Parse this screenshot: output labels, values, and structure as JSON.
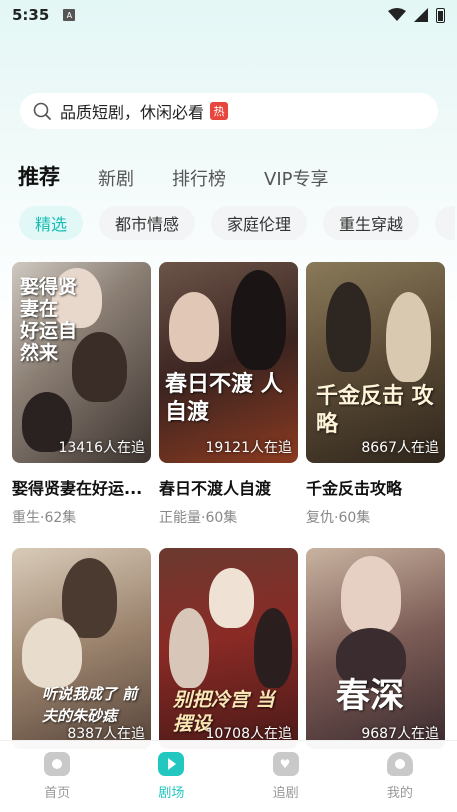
{
  "status_bar": {
    "time": "5:35",
    "sim_label": "A"
  },
  "search": {
    "placeholder": "品质短剧，休闲必看",
    "hot_badge": "热"
  },
  "tabs": [
    {
      "label": "推荐",
      "active": true
    },
    {
      "label": "新剧",
      "active": false
    },
    {
      "label": "排行榜",
      "active": false
    },
    {
      "label": "VIP专享",
      "active": false
    }
  ],
  "chips": [
    {
      "label": "精选",
      "active": true
    },
    {
      "label": "都市情感",
      "active": false
    },
    {
      "label": "家庭伦理",
      "active": false
    },
    {
      "label": "重生穿越",
      "active": false
    }
  ],
  "dramas": [
    {
      "title": "娶得贤妻在好运...",
      "meta": "重生·62集",
      "followers": "13416人在追",
      "art_title": "娶得贤妻在 好运自然来"
    },
    {
      "title": "春日不渡人自渡",
      "meta": "正能量·60集",
      "followers": "19121人在追",
      "art_title": "春日不渡 人自渡"
    },
    {
      "title": "千金反击攻略",
      "meta": "复仇·60集",
      "followers": "8667人在追",
      "art_title": "千金反击 攻略"
    },
    {
      "title": "",
      "meta": "",
      "followers": "8387人在追",
      "art_title": "听说我成了 前夫的朱砂痣"
    },
    {
      "title": "",
      "meta": "",
      "followers": "10708人在追",
      "art_title": "别把冷宫 当摆设"
    },
    {
      "title": "",
      "meta": "",
      "followers": "9687人在追",
      "art_title": "春深"
    }
  ],
  "bottom_nav": [
    {
      "label": "首页",
      "active": false,
      "icon": "home-icon"
    },
    {
      "label": "剧场",
      "active": true,
      "icon": "play-icon"
    },
    {
      "label": "追剧",
      "active": false,
      "icon": "heart-icon"
    },
    {
      "label": "我的",
      "active": false,
      "icon": "person-icon"
    }
  ],
  "colors": {
    "accent": "#22c7c0",
    "hot": "#e8453c"
  }
}
